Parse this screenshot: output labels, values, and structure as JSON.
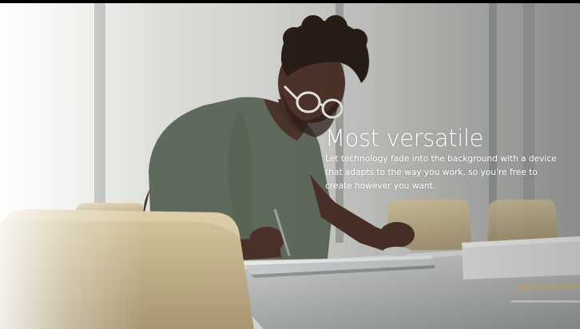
{
  "hero": {
    "title": "Most versatile",
    "body": "Let technology fade into the background with a device that adapts to the way you work, so you're free to create however you want."
  },
  "photo": {
    "subject": "man with glasses sketching on a laptop with a stylus at a conference table",
    "colors": {
      "wall": "#d4d5d1",
      "shirt": "#5f6a5c",
      "skin": "#4a3128",
      "chair": "#c9b88f",
      "table": "#b8bab9"
    }
  }
}
